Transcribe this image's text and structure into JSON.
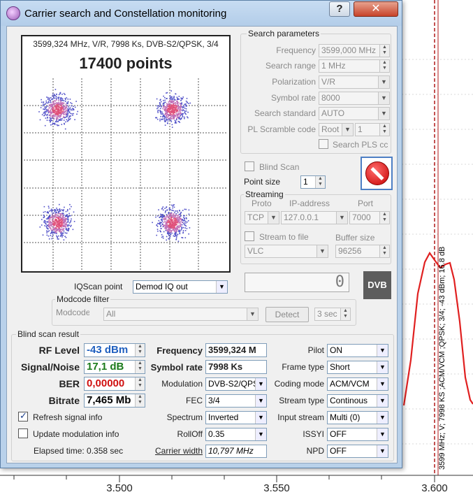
{
  "window": {
    "title": "Carrier search and Constellation monitoring",
    "help_label": "?",
    "close_label": "✕"
  },
  "constellation": {
    "info": "3599,324 MHz, V/R, 7998 Ks, DVB-S2/QPSK, 3/4",
    "points": "17400 points"
  },
  "search_params": {
    "title": "Search parameters",
    "frequency_label": "Frequency",
    "frequency_value": "3599,000 MHz",
    "search_range_label": "Search range",
    "search_range_value": "1 MHz",
    "polarization_label": "Polarization",
    "polarization_value": "V/R",
    "symbol_rate_label": "Symbol rate",
    "symbol_rate_value": "8000",
    "search_standard_label": "Search standard",
    "search_standard_value": "AUTO",
    "pl_scramble_label": "PL Scramble code",
    "pl_scramble_value": "Root",
    "pl_scramble_num": "1",
    "search_pls_label": "Search PLS cc"
  },
  "blind_scan": {
    "label": "Blind Scan",
    "point_size_label": "Point size",
    "point_size_value": "1"
  },
  "streaming": {
    "title": "Streaming",
    "proto_label": "Proto",
    "proto_value": "TCP",
    "ip_label": "IP-address",
    "ip_value": "127.0.0.1",
    "port_label": "Port",
    "port_value": "7000",
    "stream_to_file_label": "Stream to file",
    "buffer_label": "Buffer size",
    "player_value": "VLC",
    "buffer_value": "96256"
  },
  "lcd_value": "0",
  "dvb_logo": "DVB",
  "iqscan": {
    "label": "IQScan point",
    "value": "Demod IQ out"
  },
  "modcode": {
    "title": "Modcode filter",
    "label": "Modcode",
    "value": "All",
    "detect_label": "Detect",
    "time_value": "3 sec"
  },
  "result": {
    "title": "Blind scan result",
    "rf_level_label": "RF Level",
    "rf_level_value": "-43 dBm",
    "snr_label": "Signal/Noise",
    "snr_value": "17,1 dB",
    "ber_label": "BER",
    "ber_value": "0,00000",
    "bitrate_label": "Bitrate",
    "bitrate_value": "7,465 Mb",
    "frequency_label": "Frequency",
    "frequency_value": "3599,324 M",
    "symbol_rate_label": "Symbol rate",
    "symbol_rate_value": "7998 Ks",
    "modulation_label": "Modulation",
    "modulation_value": "DVB-S2/QPS",
    "fec_label": "FEC",
    "fec_value": "3/4",
    "spectrum_label": "Spectrum",
    "spectrum_value": "Inverted",
    "rolloff_label": "RollOff",
    "rolloff_value": "0.35",
    "carrier_width_label": "Carrier width",
    "carrier_width_value": "10,797 MHz",
    "pilot_label": "Pilot",
    "pilot_value": "ON",
    "frame_type_label": "Frame type",
    "frame_type_value": "Short",
    "coding_mode_label": "Coding mode",
    "coding_mode_value": "ACM/VCM",
    "stream_type_label": "Stream type",
    "stream_type_value": "Continous",
    "input_stream_label": "Input stream",
    "input_stream_value": "Multi (0)",
    "issyi_label": "ISSYI",
    "issyi_value": "OFF",
    "npd_label": "NPD",
    "npd_value": "OFF",
    "refresh_label": "Refresh signal info",
    "update_mod_label": "Update modulation info",
    "elapsed_label": "Elapsed time: 0.358 sec"
  },
  "colors": {
    "rf_level": "#1f5fbf",
    "snr": "#1a7a1a",
    "ber": "#d01010",
    "spectrum_line": "#e02020"
  },
  "spectrum_bg": {
    "x_ticks": [
      "3.500",
      "3.550",
      "3.600"
    ],
    "marker_label": "3599 MHz; V; 7998 KS ;ACM/VCM ;QPSK; 3/4; -43 dBm; 16.8 dB"
  }
}
